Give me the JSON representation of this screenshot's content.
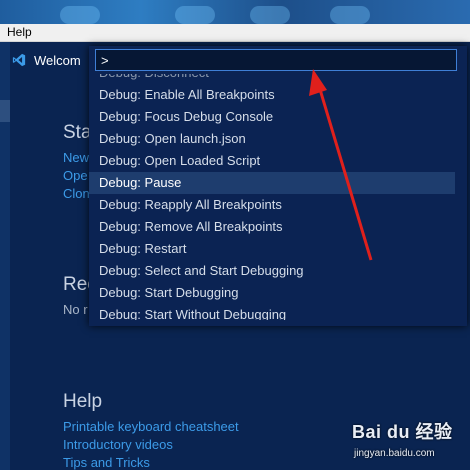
{
  "menu": {
    "help_label": "Help"
  },
  "tab": {
    "label": "Welcom"
  },
  "command_palette": {
    "input_value": ">",
    "items": [
      "Debug: Disconnect",
      "Debug: Enable All Breakpoints",
      "Debug: Focus Debug Console",
      "Debug: Open launch.json",
      "Debug: Open Loaded Script",
      "Debug: Pause",
      "Debug: Reapply All Breakpoints",
      "Debug: Remove All Breakpoints",
      "Debug: Restart",
      "Debug: Select and Start Debugging",
      "Debug: Start Debugging",
      "Debug: Start Without Debugging"
    ],
    "active_item": "Debug: Pause"
  },
  "welcome": {
    "start_heading": "Sta",
    "start_links": [
      "New",
      "Ope",
      "Clon"
    ],
    "recent_heading": "Rec",
    "recent_text": "No r",
    "help_heading": "Help",
    "help_links": [
      "Printable keyboard cheatsheet",
      "Introductory videos",
      "Tips and Tricks"
    ]
  },
  "watermark": {
    "logo": "Bai du 经验",
    "url": "jingyan.baidu.com"
  },
  "colors": {
    "background": "#0a2451",
    "link": "#3c9be8",
    "arrow": "#e0201c",
    "palette_active": "#1e3d6e"
  }
}
